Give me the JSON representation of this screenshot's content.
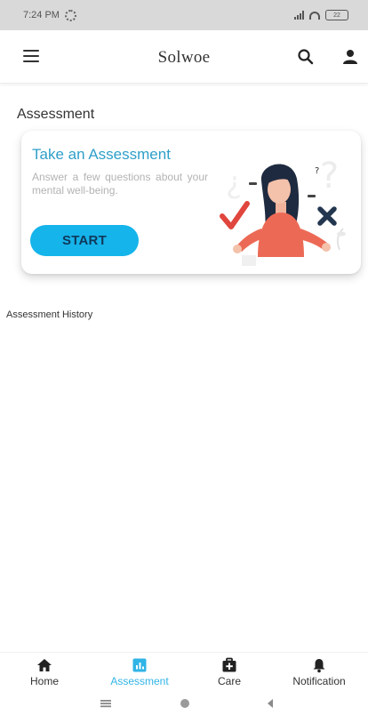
{
  "status_bar": {
    "time": "7:24 PM",
    "battery": "22"
  },
  "app_bar": {
    "title": "Solwoe"
  },
  "main": {
    "section_title": "Assessment",
    "card": {
      "title": "Take an Assessment",
      "description": "Answer a few questions about your mental well-being.",
      "start_label": "START"
    },
    "history_title": "Assessment History"
  },
  "bottom_nav": {
    "items": [
      {
        "label": "Home",
        "icon": "home-icon"
      },
      {
        "label": "Assessment",
        "icon": "assessment-icon",
        "active": true
      },
      {
        "label": "Care",
        "icon": "first-aid-kit-icon"
      },
      {
        "label": "Notification",
        "icon": "bell-icon"
      }
    ]
  },
  "colors": {
    "accent": "#15b4ea",
    "title_accent": "#2f9fc9",
    "active_nav": "#30b4e6"
  }
}
